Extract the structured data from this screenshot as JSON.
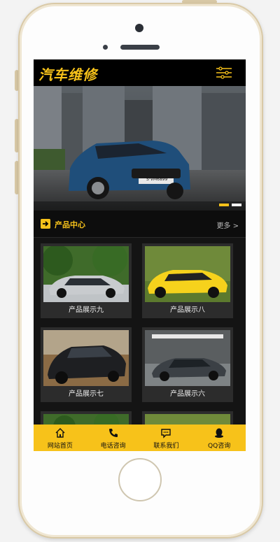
{
  "app": {
    "logo_text": "汽车维修"
  },
  "banner": {
    "plate_text": "S·VM6899"
  },
  "section": {
    "title": "产品中心",
    "more_label": "更多 >"
  },
  "products": [
    {
      "label": "产品展示九"
    },
    {
      "label": "产品展示八"
    },
    {
      "label": "产品展示七"
    },
    {
      "label": "产品展示六"
    }
  ],
  "footer": {
    "items": [
      {
        "label": "网站首页",
        "icon": "home-icon"
      },
      {
        "label": "电话咨询",
        "icon": "phone-icon"
      },
      {
        "label": "联系我们",
        "icon": "chat-icon"
      },
      {
        "label": "QQ咨询",
        "icon": "qq-icon"
      }
    ]
  },
  "colors": {
    "accent": "#f7c21a",
    "background": "#141414",
    "header": "#000000"
  }
}
